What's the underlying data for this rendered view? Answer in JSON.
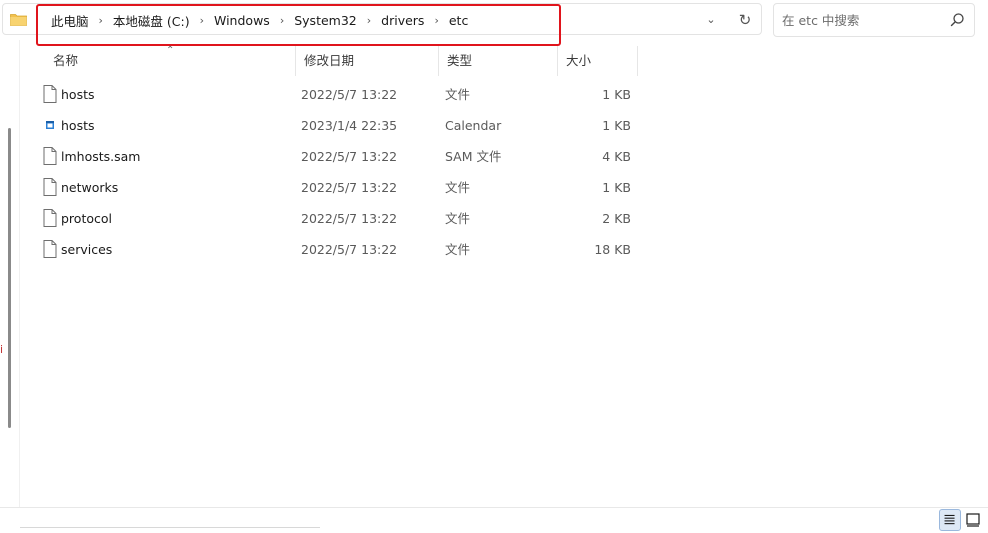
{
  "address": {
    "crumbs": [
      "此电脑",
      "本地磁盘 (C:)",
      "Windows",
      "System32",
      "drivers",
      "etc"
    ],
    "icons": [
      "folder-icon",
      "chevron-right-icon",
      "chevron-down-icon",
      "refresh-icon"
    ]
  },
  "search": {
    "placeholder": "在 etc 中搜索",
    "value": "",
    "icon": "search-icon"
  },
  "columns": {
    "name": "名称",
    "date": "修改日期",
    "type": "类型",
    "size": "大小"
  },
  "files": [
    {
      "name": "hosts",
      "date": "2022/5/7 13:22",
      "type": "文件",
      "size": "1 KB",
      "icon": "file-icon"
    },
    {
      "name": "hosts",
      "date": "2023/1/4 22:35",
      "type": "Calendar",
      "size": "1 KB",
      "icon": "calendar-file-icon"
    },
    {
      "name": "lmhosts.sam",
      "date": "2022/5/7 13:22",
      "type": "SAM 文件",
      "size": "4 KB",
      "icon": "file-icon"
    },
    {
      "name": "networks",
      "date": "2022/5/7 13:22",
      "type": "文件",
      "size": "1 KB",
      "icon": "file-icon"
    },
    {
      "name": "protocol",
      "date": "2022/5/7 13:22",
      "type": "文件",
      "size": "2 KB",
      "icon": "file-icon"
    },
    {
      "name": "services",
      "date": "2022/5/7 13:22",
      "type": "文件",
      "size": "18 KB",
      "icon": "file-icon"
    }
  ],
  "view": {
    "active": "details",
    "icons": [
      "details-view-icon",
      "large-icons-view-icon"
    ]
  },
  "colors": {
    "highlight": "#e0141c",
    "accent": "#0067c0",
    "folder": "#f2c14e"
  }
}
